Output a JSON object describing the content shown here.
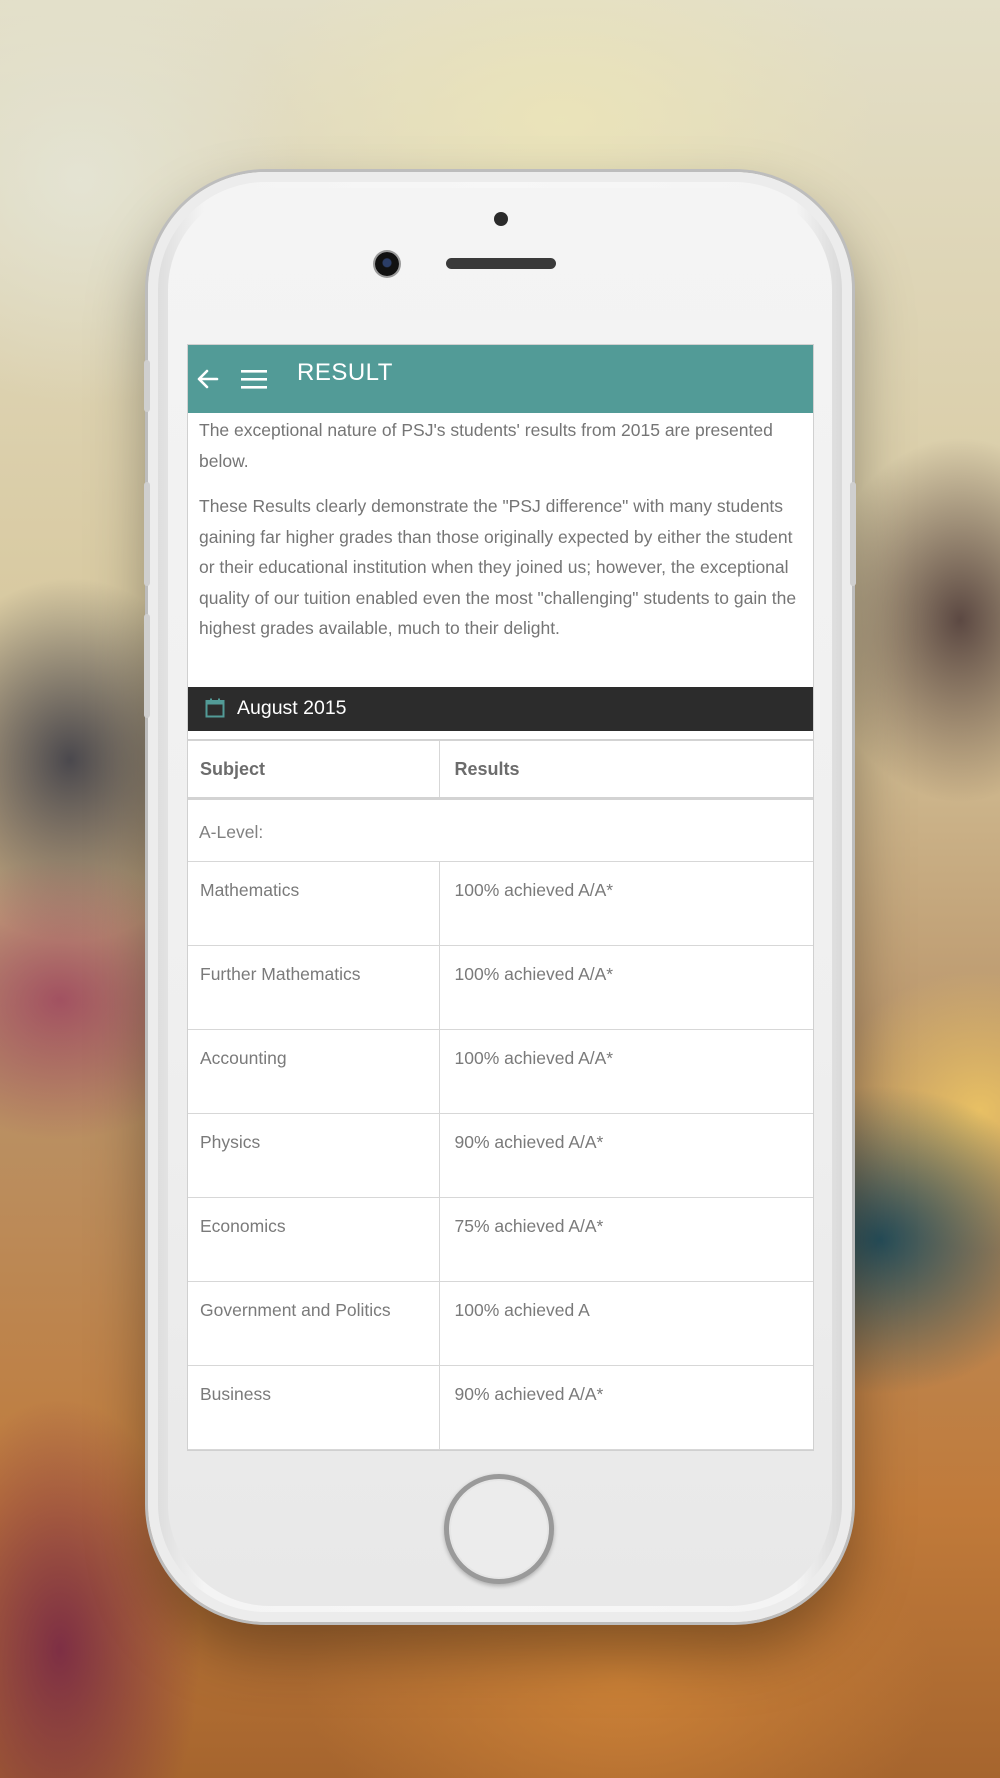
{
  "app": {
    "title": "RESULT",
    "back_icon": "arrow-left-icon",
    "menu_icon": "hamburger-menu-icon",
    "header_color": "#529b97"
  },
  "intro": {
    "paragraph1": "The exceptional nature of PSJ's students' results from 2015 are presented below.",
    "paragraph2": "These Results clearly demonstrate the \"PSJ difference\" with many students gaining far higher grades than those originally expected by either the student or their educational institution when they joined us; however, the exceptional quality of our tuition enabled even the most \"challenging\" students to gain the highest grades available, much to their delight."
  },
  "date_section": {
    "icon": "calendar-icon",
    "label": "August 2015",
    "bar_color": "#2c2c2c",
    "icon_color": "#529b97"
  },
  "table": {
    "headers": [
      "Subject",
      "Results"
    ],
    "section_label": "A-Level:",
    "rows": [
      {
        "subject": "Mathematics",
        "result": "100% achieved A/A*"
      },
      {
        "subject": "Further Mathematics",
        "result": "100% achieved A/A*"
      },
      {
        "subject": "Accounting",
        "result": "100% achieved A/A*"
      },
      {
        "subject": "Physics",
        "result": "90% achieved A/A*"
      },
      {
        "subject": "Economics",
        "result": "75% achieved A/A*"
      },
      {
        "subject": "Government and Politics",
        "result": "100% achieved A"
      },
      {
        "subject": "Business",
        "result": "90% achieved A/A*"
      }
    ]
  }
}
